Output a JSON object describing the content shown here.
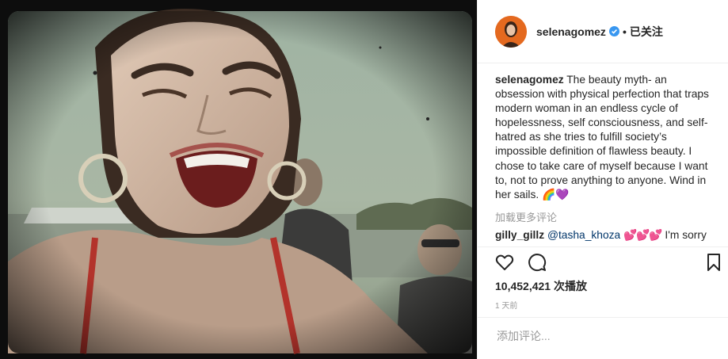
{
  "header": {
    "username": "selenagomez",
    "verified_icon": "verified-badge-icon",
    "dot": "•",
    "follow_status": "已关注"
  },
  "caption": {
    "username": "selenagomez",
    "text": "The beauty myth- an obsession with physical perfection that traps modern woman in an endless cycle of hopelessness, self consciousness, and self-hatred as she tries to fulfill society’s impossible definition of flawless beauty. I chose to take care of myself because I want to, not to prove anything to anyone. Wind in her sails. ",
    "emoji": "🌈💜"
  },
  "load_more": "加载更多评论",
  "comment": {
    "username": "gilly_gillz",
    "mention": "@tasha_khoza",
    "hearts": "💕💕💕",
    "text": " I'm sorry"
  },
  "actions": {
    "like_icon": "heart-icon",
    "comment_icon": "comment-icon",
    "save_icon": "bookmark-icon"
  },
  "stats": {
    "views": "10,452,421",
    "views_label": "次播放"
  },
  "timestamp": "1 天前",
  "add_comment": {
    "placeholder": "添加评论..."
  },
  "colors": {
    "accent": "#3897f0",
    "link": "#003569",
    "muted": "#999999",
    "avatar": "#e4691f"
  }
}
